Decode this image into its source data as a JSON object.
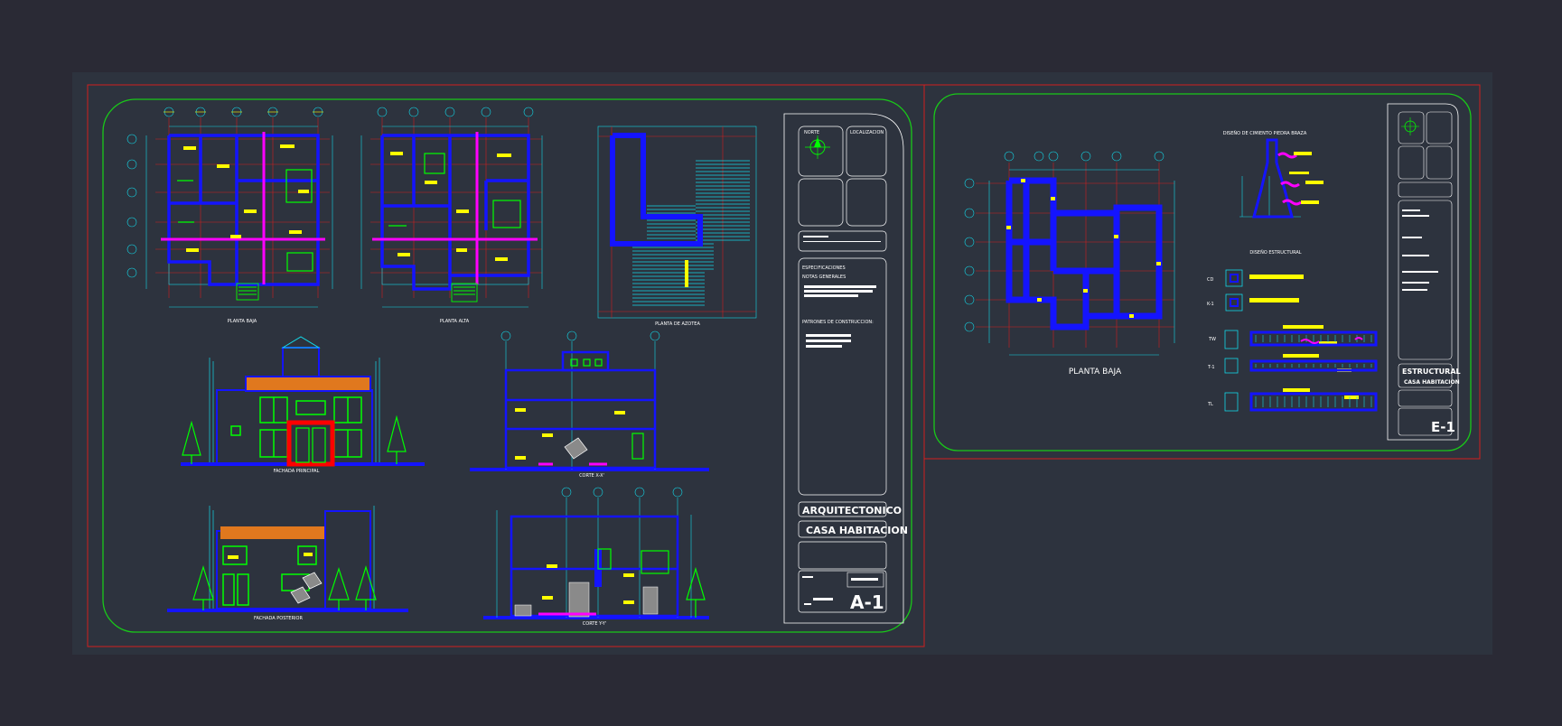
{
  "drawing_sheets": {
    "architectural": {
      "views": {
        "ground_floor": "PLANTA BAJA",
        "upper_floor": "PLANTA ALTA",
        "roof_plan": "PLANTA DE AZOTEA",
        "main_facade": "FACHADA PRINCIPAL",
        "section_xx": "CORTE X-X'",
        "rear_facade": "FACHADA POSTERIOR",
        "section_yy": "CORTE Y-Y'"
      },
      "title_block": {
        "cell_north": "NORTE",
        "cell_location": "LOCALIZACION",
        "specs_title": "ESPECIFICACIONES",
        "general_notes": "NOTAS GENERALES",
        "construction_patterns": "PATRONES DE CONSTRUCCION:",
        "discipline": "ARQUITECTONICO",
        "project": "CASA HABITACION",
        "sheet_number": "A-1"
      }
    },
    "structural": {
      "views": {
        "ground_floor": "PLANTA BAJA",
        "foundation_detail": "DISEÑO DE CIMIENTO PIEDRA BRAZA",
        "structural_design": "DISEÑO ESTRUCTURAL"
      },
      "schedule_marks": [
        "CD",
        "K-1",
        "TW",
        "T-1",
        "TL"
      ],
      "title_block": {
        "discipline": "ESTRUCTURAL",
        "project": "CASA HABITACION",
        "sheet_number": "E-1"
      }
    }
  },
  "colors": {
    "background": "#2a2a35",
    "model_space": "#2d333e",
    "sheet_border": "#d11f1f",
    "viewport_frame": "#19c819",
    "wall": "#1414ff",
    "grid": "#d11f1f",
    "dimension": "#13d7e7",
    "text_tag": "#ffff00",
    "accent": "#ff00ff",
    "window": "#00ff00",
    "roof_tile": "#e0781e"
  }
}
